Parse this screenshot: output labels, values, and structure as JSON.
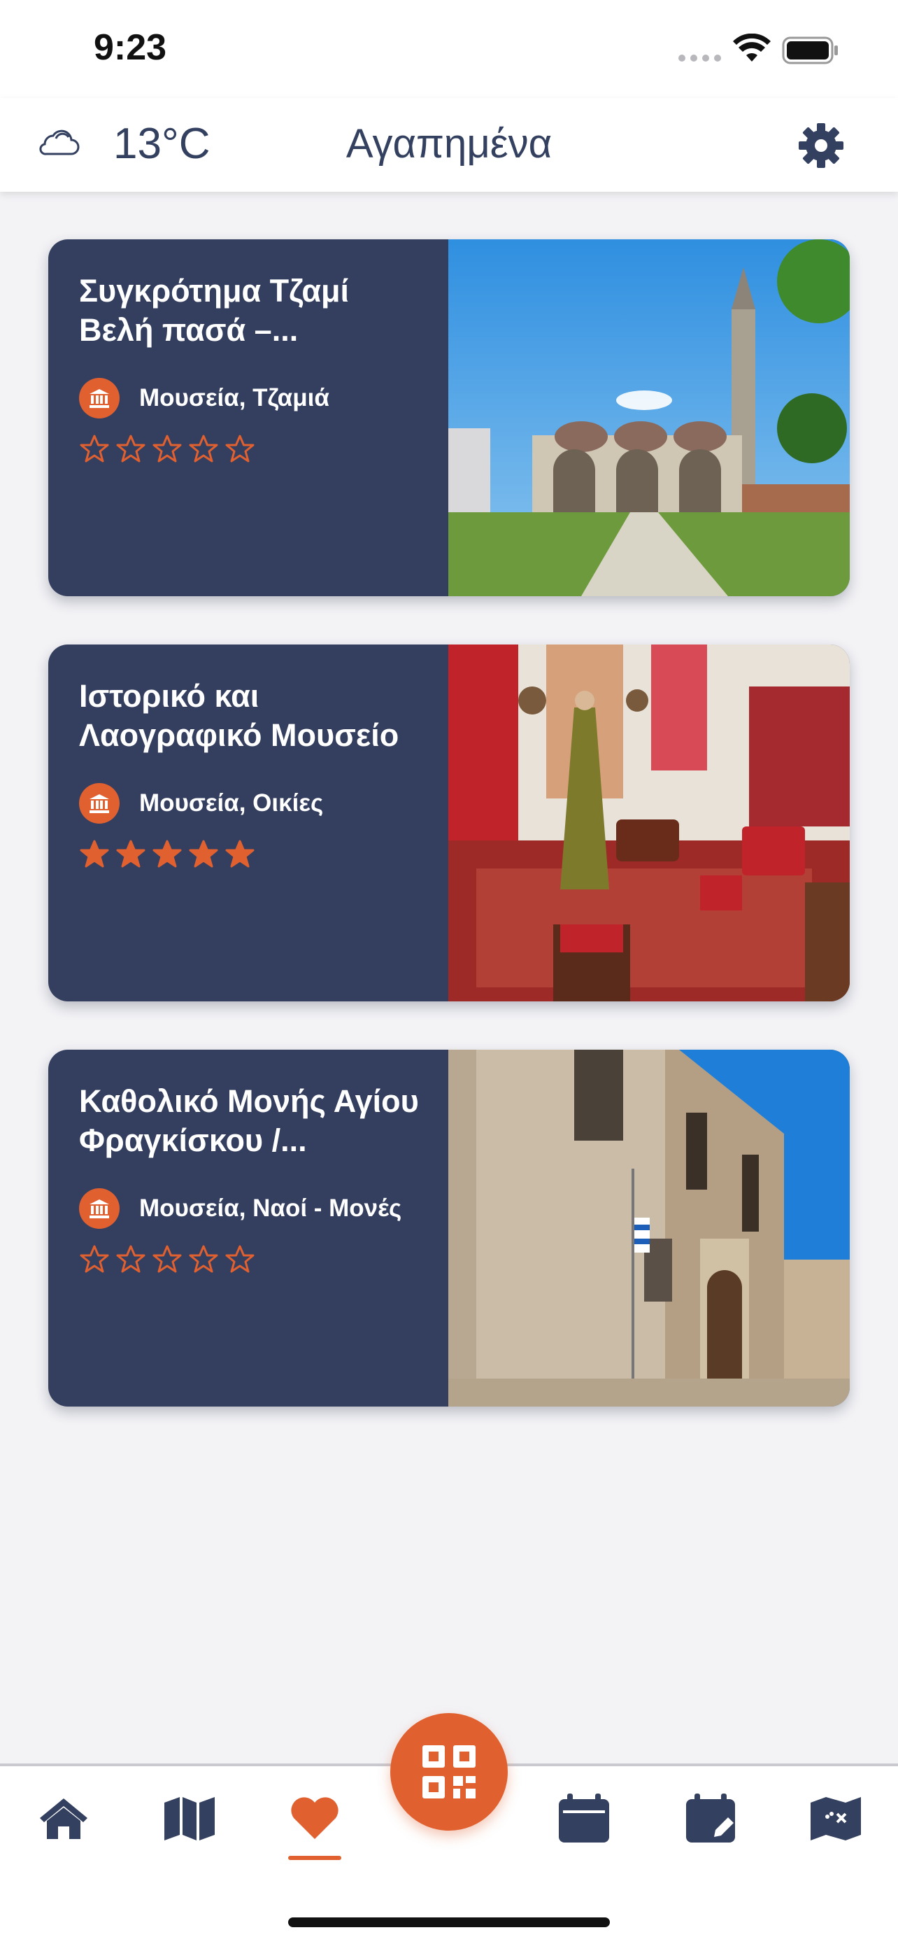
{
  "status_bar": {
    "time": "9:23"
  },
  "header": {
    "temperature": "13°C",
    "title": "Αγαπημένα",
    "weather_icon": "cloud-icon",
    "settings_icon": "gear-icon"
  },
  "favorites": [
    {
      "title": "Συγκρότημα Τζαμί Βελή πασά –...",
      "category": "Μουσεία, Τζαμιά",
      "rating": 0,
      "category_icon": "museum-icon"
    },
    {
      "title": "Ιστορικό και Λαογραφικό Μουσείο",
      "category": "Μουσεία, Οικίες",
      "rating": 5,
      "category_icon": "museum-icon"
    },
    {
      "title": "Καθολικό Μονής Αγίου Φραγκίσκου /...",
      "category": "Μουσεία, Ναοί - Μονές",
      "rating": 0,
      "category_icon": "museum-icon"
    }
  ],
  "bottom_nav": {
    "items": [
      "home-icon",
      "map-icon",
      "heart-icon",
      "qr-code-icon",
      "calendar-icon",
      "calendar-edit-icon",
      "map-x-icon"
    ],
    "active": "heart-icon"
  },
  "colors": {
    "accent": "#e06030",
    "navy": "#343f5f",
    "background": "#f3f3f6"
  }
}
